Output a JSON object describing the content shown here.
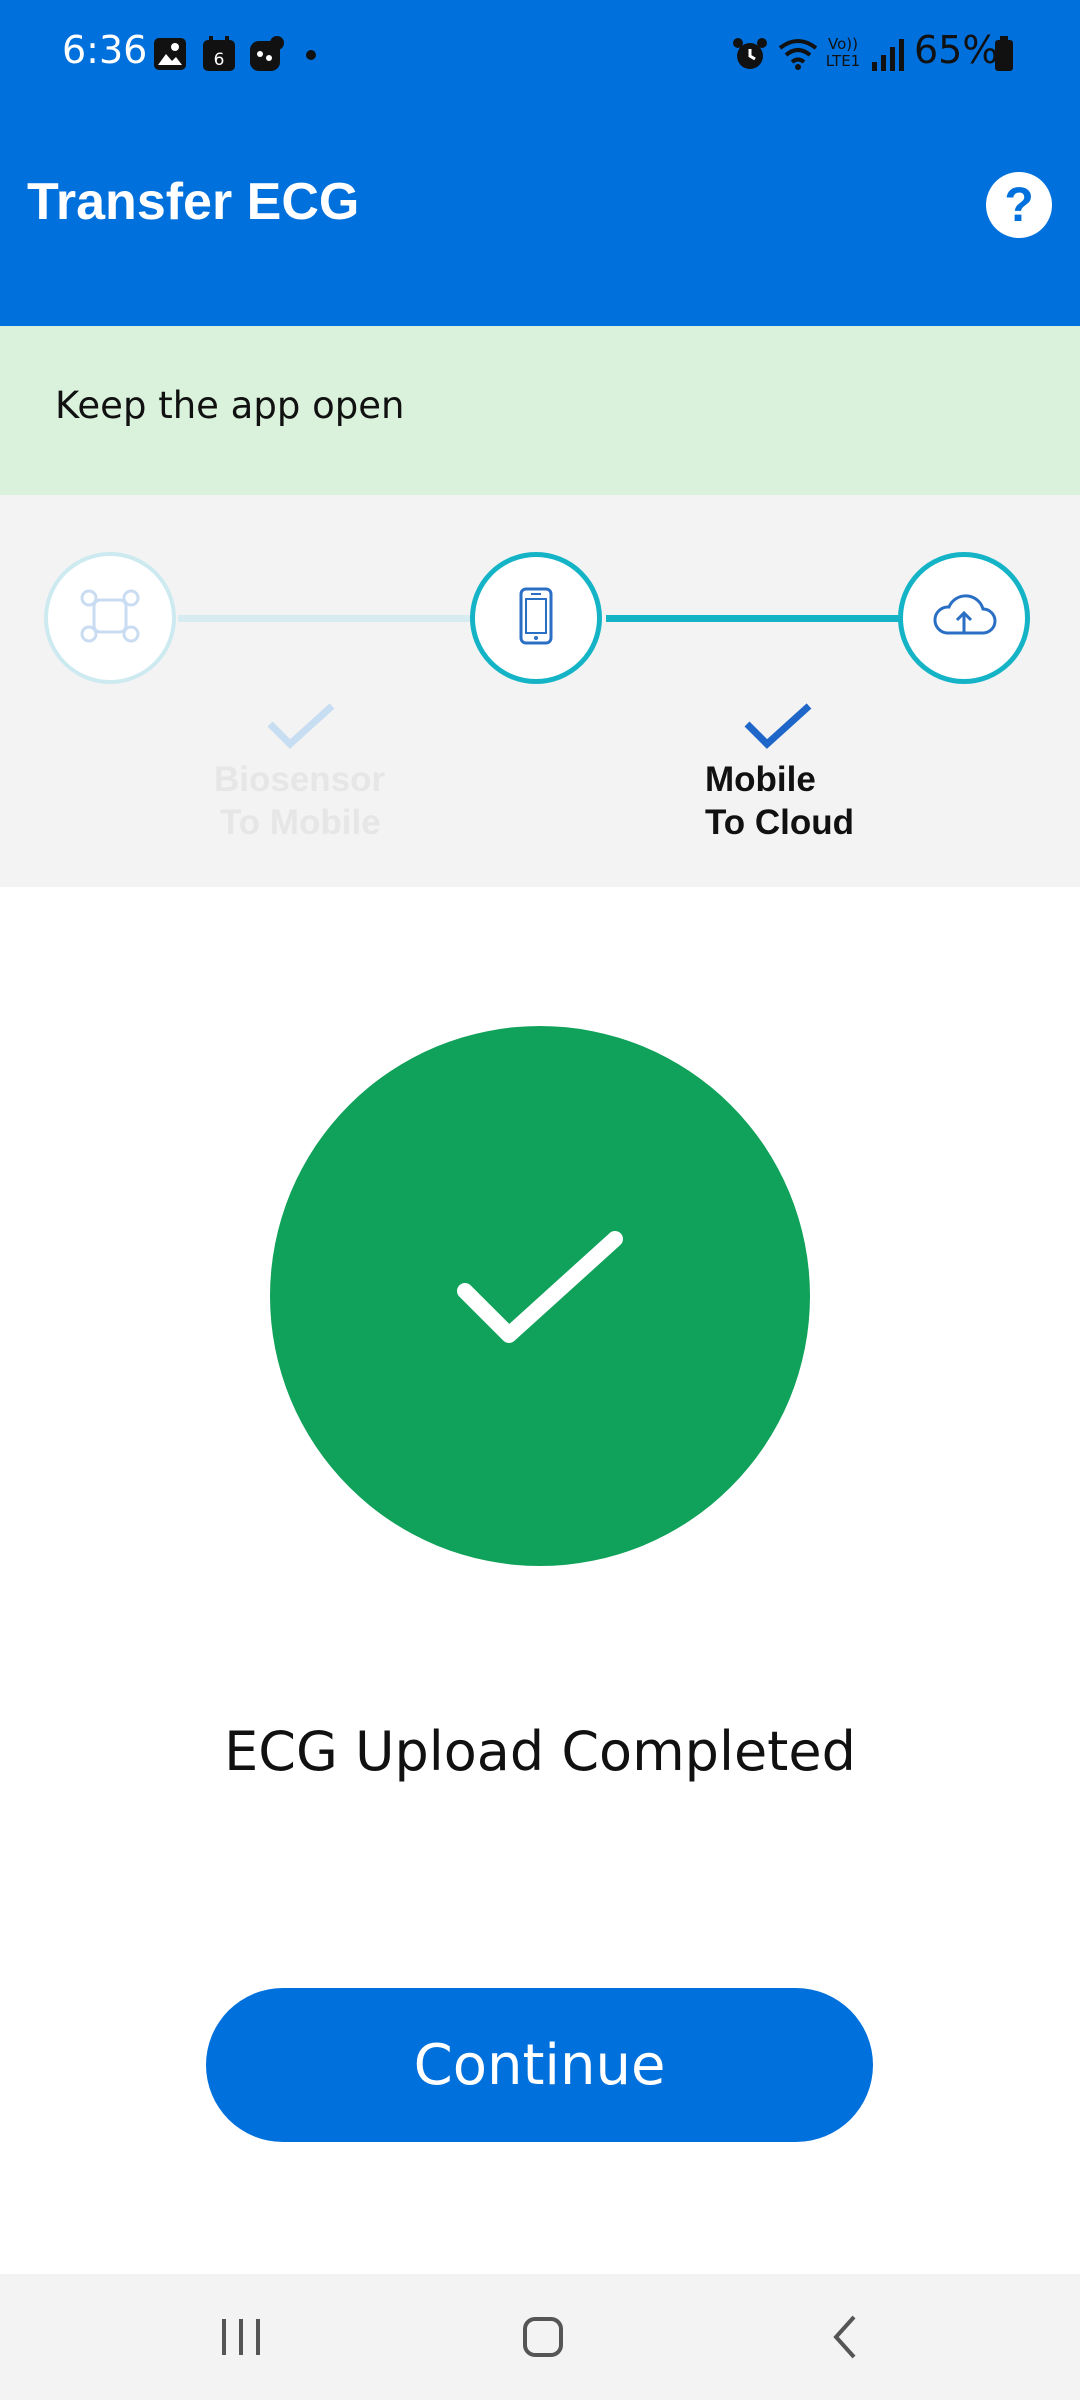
{
  "status_bar": {
    "time": "6:36",
    "battery": "65%",
    "icons": [
      "gallery-icon",
      "calendar-icon",
      "app-icon",
      "dot-icon",
      "alarm-icon",
      "wifi-icon",
      "volte-icon",
      "signal-icon",
      "battery-icon"
    ],
    "calendar_day": "6",
    "volte_top": "Vo))",
    "volte_bottom": "LTE1"
  },
  "header": {
    "title": "Transfer ECG",
    "help_label": "?"
  },
  "banner": {
    "text": "Keep the app open"
  },
  "stepper": {
    "steps": [
      {
        "label_line1": "Biosensor",
        "label_line2": "To Mobile",
        "icon": "biosensor-icon",
        "state": "faded"
      },
      {
        "label_line1": "Mobile",
        "label_line2": "To Cloud",
        "icon": "mobile-icon",
        "state": "active"
      },
      {
        "icon": "cloud-upload-icon",
        "state": "active"
      }
    ]
  },
  "result": {
    "message": "ECG Upload Completed",
    "button_label": "Continue"
  },
  "colors": {
    "primary": "#0070dc",
    "banner_bg": "#daf2db",
    "teal": "#14b4c6",
    "success": "#10a25a",
    "faded": "#cdeaf0"
  }
}
